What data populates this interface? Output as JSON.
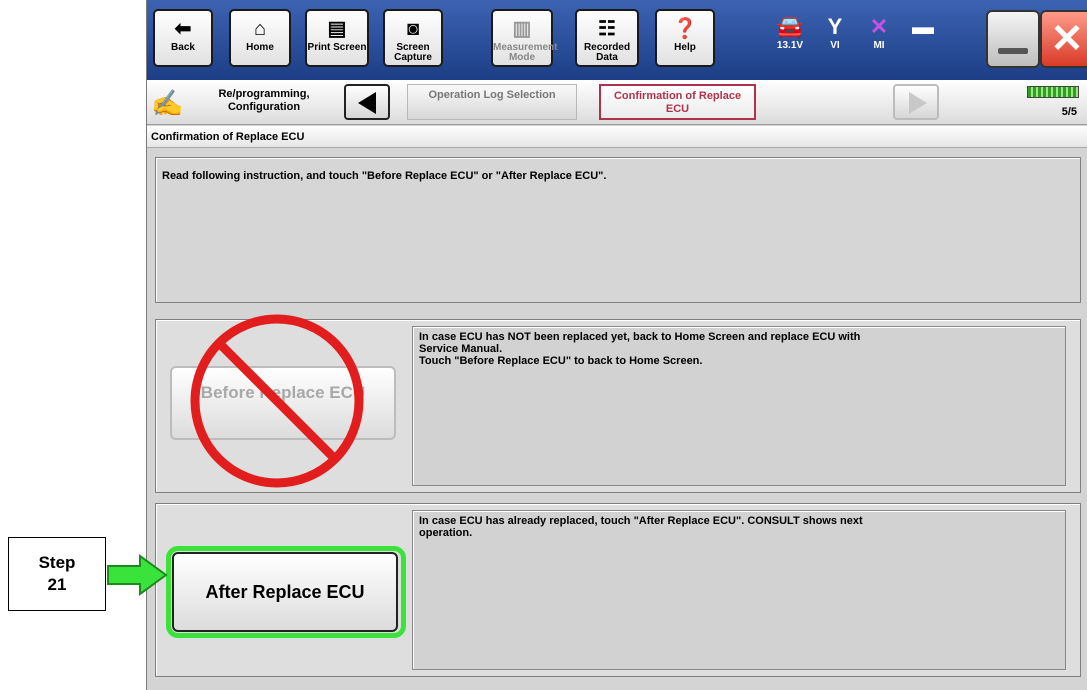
{
  "toolbar": {
    "buttons": [
      {
        "label": "Back",
        "icon": "back-arrow-icon"
      },
      {
        "label": "Home",
        "icon": "home-icon"
      },
      {
        "label": "Print Screen",
        "icon": "printer-icon"
      },
      {
        "label": "Screen Capture",
        "icon": "camera-icon"
      },
      {
        "label": "Measurement Mode",
        "icon": "measurement-icon"
      },
      {
        "label": "Recorded Data",
        "icon": "recorded-data-icon"
      },
      {
        "label": "Help",
        "icon": "help-icon"
      }
    ],
    "status": {
      "voltage": "13.1V",
      "vi": "VI",
      "mi": "MI"
    }
  },
  "breadcrumb": {
    "title": "Re/programming, Configuration",
    "previous_step": "Operation Log Selection",
    "current_step": "Confirmation of Replace ECU",
    "page": "5/5",
    "progress": 1.0
  },
  "page_title": "Confirmation of Replace ECU",
  "instruction": "Read following instruction, and touch \"Before Replace ECU\" or \"After Replace ECU\".",
  "before": {
    "button_label": "Before Replace ECU",
    "description": "In case ECU has NOT been replaced yet, back to Home Screen and replace ECU with\nService  Manual.\nTouch \"Before Replace ECU\" to back to Home Screen."
  },
  "after": {
    "button_label": "After Replace ECU",
    "description": "In case ECU has already replaced, touch \"After Replace ECU\". CONSULT shows next\noperation."
  },
  "callout": {
    "step_label": "Step\n21"
  },
  "colors": {
    "toolbar_blue": "#1d3e86",
    "current_step_border": "#b0314b",
    "highlight_green": "#39e33a",
    "no_sign_red": "#e21d1d"
  }
}
